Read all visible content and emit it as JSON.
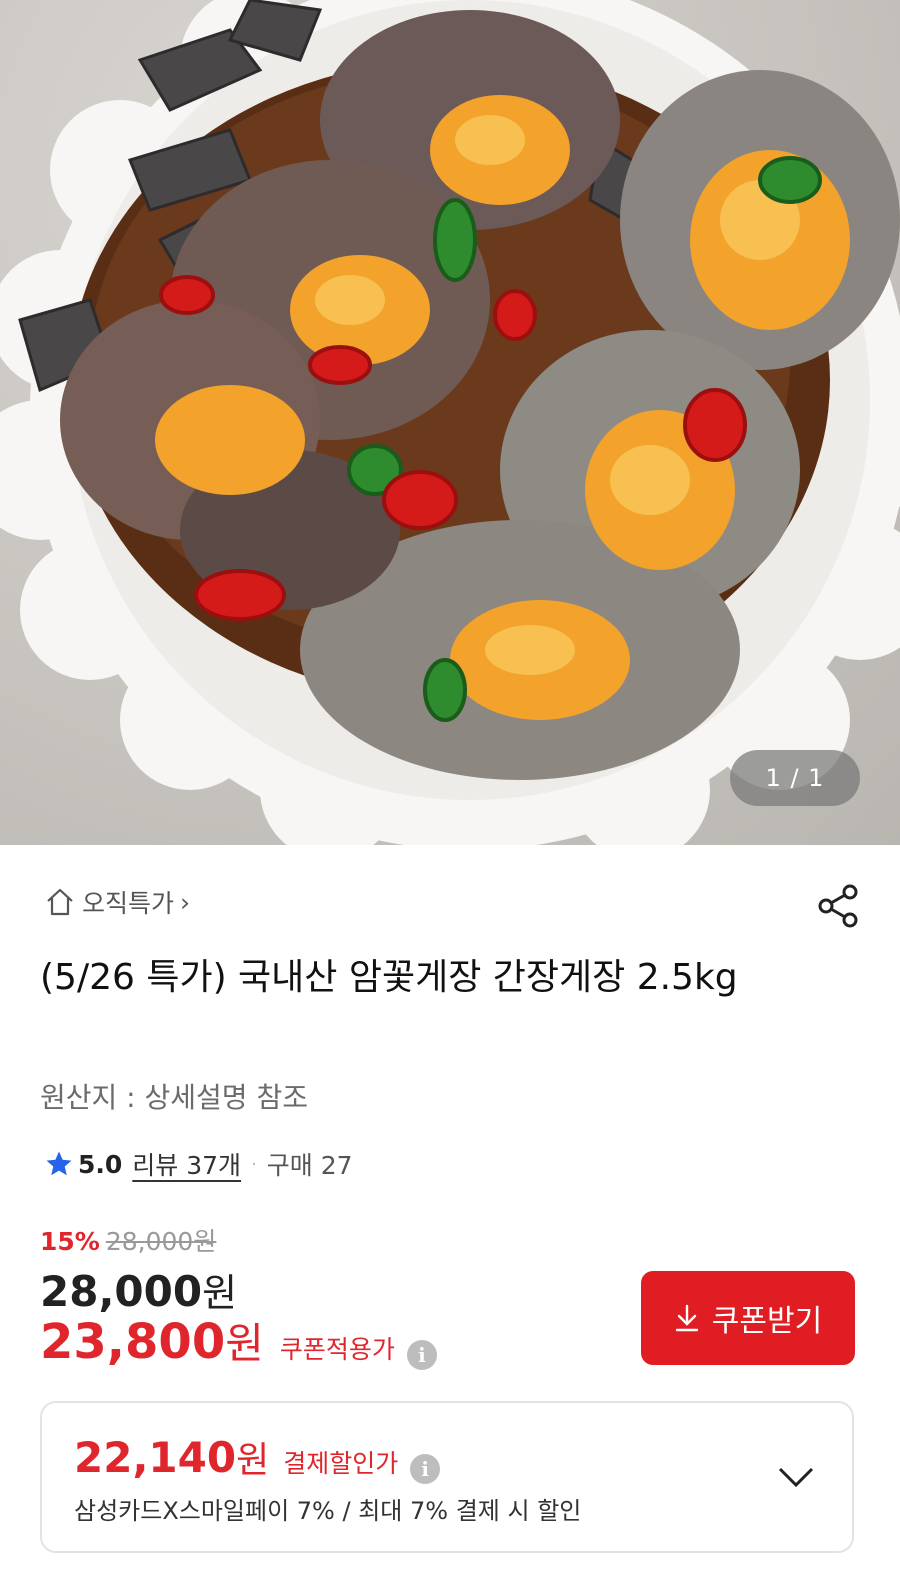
{
  "gallery": {
    "counter": "1 / 1"
  },
  "breadcrumb": {
    "label": "오직특가",
    "chevron": "›"
  },
  "product": {
    "title": "(5/26 특가) 국내산 암꽃게장 간장게장 2.5kg",
    "origin": "원산지 : 상세설명 참조"
  },
  "rating": {
    "score": "5.0",
    "reviews": "리뷰 37개",
    "separator": "·",
    "purchases": "구매 27"
  },
  "pricing": {
    "discount_pct": "15%",
    "original": "28,000",
    "original_unit": "원",
    "price": "28,000",
    "price_unit": "원",
    "coupon_price": "23,800",
    "coupon_unit": "원",
    "coupon_label": "쿠폰적용가",
    "info_glyph": "i"
  },
  "coupon_button": {
    "label": "쿠폰받기"
  },
  "payment": {
    "price": "22,140",
    "unit": "원",
    "label": "결제할인가",
    "info_glyph": "i",
    "detail": "삼성카드X스마일페이 7% / 최대 7% 결제 시 할인"
  },
  "colors": {
    "accent_red": "#e0262d",
    "button_red": "#e11d24"
  },
  "icons": [
    "home-icon",
    "share-icon",
    "star-icon",
    "info-icon",
    "download-icon",
    "chevron-down-icon"
  ]
}
